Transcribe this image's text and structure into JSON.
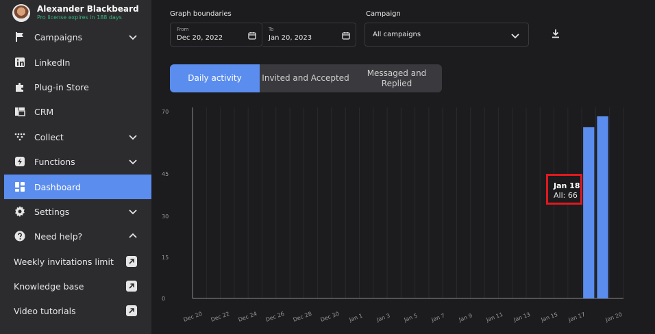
{
  "user": {
    "name": "Alexander Blackbeard",
    "license": "Pro license expires in 188 days"
  },
  "sidebar": {
    "items": [
      {
        "label": "Campaigns",
        "icon": "flag-icon",
        "chevron": "down"
      },
      {
        "label": "LinkedIn",
        "icon": "linkedin-icon",
        "chevron": ""
      },
      {
        "label": "Plug-in Store",
        "icon": "puzzle-icon",
        "chevron": ""
      },
      {
        "label": "CRM",
        "icon": "crm-icon",
        "chevron": ""
      },
      {
        "label": "Collect",
        "icon": "collect-icon",
        "chevron": "down"
      },
      {
        "label": "Functions",
        "icon": "lightning-icon",
        "chevron": "down"
      },
      {
        "label": "Dashboard",
        "icon": "dashboard-icon",
        "chevron": "",
        "active": true
      },
      {
        "label": "Settings",
        "icon": "gear-icon",
        "chevron": "down"
      },
      {
        "label": "Need help?",
        "icon": "help-icon",
        "chevron": "up"
      }
    ],
    "help_links": [
      {
        "label": "Weekly invitations limit"
      },
      {
        "label": "Knowledge base"
      },
      {
        "label": "Video tutorials"
      }
    ]
  },
  "filters": {
    "boundaries_label": "Graph boundaries",
    "from_label": "From",
    "from_value": "Dec 20, 2022",
    "to_label": "To",
    "to_value": "Jan 20, 2023",
    "campaign_label": "Campaign",
    "campaign_value": "All campaigns"
  },
  "tabs": [
    "Daily activity",
    "Invited and Accepted",
    "Messaged and Replied"
  ],
  "tooltip": {
    "date": "Jan 18",
    "value": "All: 66"
  },
  "colors": {
    "accent": "#5b8def",
    "sidebar": "#2c2c2f",
    "background": "#1c1c1e",
    "tooltip_border": "#e0191f"
  },
  "chart_data": {
    "type": "bar",
    "x_ticks": [
      "Dec 20",
      "Dec 22",
      "Dec 24",
      "Dec 26",
      "Dec 28",
      "Dec 30",
      "Jan 1",
      "Jan 3",
      "Jan 5",
      "Jan 7",
      "Jan 9",
      "Jan 11",
      "Jan 13",
      "Jan 15",
      "Jan 17",
      "Jan 20"
    ],
    "y_ticks": [
      "70",
      "45",
      "30",
      "15",
      "0"
    ],
    "categories": [
      "Dec 20",
      "Dec 21",
      "Dec 22",
      "Dec 23",
      "Dec 24",
      "Dec 25",
      "Dec 26",
      "Dec 27",
      "Dec 28",
      "Dec 29",
      "Dec 30",
      "Dec 31",
      "Jan 1",
      "Jan 2",
      "Jan 3",
      "Jan 4",
      "Jan 5",
      "Jan 6",
      "Jan 7",
      "Jan 8",
      "Jan 9",
      "Jan 10",
      "Jan 11",
      "Jan 12",
      "Jan 13",
      "Jan 14",
      "Jan 15",
      "Jan 16",
      "Jan 17",
      "Jan 18",
      "Jan 19"
    ],
    "series": [
      {
        "values": [
          0,
          0,
          0,
          0,
          0,
          0,
          0,
          0,
          0,
          0,
          0,
          0,
          0,
          0,
          0,
          0,
          0,
          0,
          0,
          0,
          0,
          0,
          0,
          0,
          0,
          0,
          0,
          0,
          62,
          66,
          0
        ]
      }
    ],
    "ylim": [
      0,
      70
    ],
    "grid": true
  }
}
